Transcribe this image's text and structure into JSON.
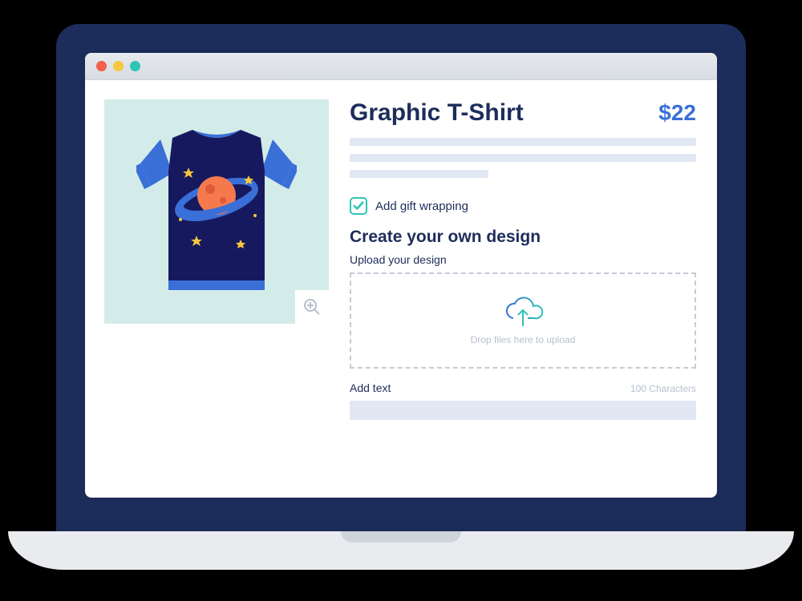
{
  "product": {
    "title": "Graphic T-Shirt",
    "price": "$22",
    "gift_wrap_label": "Add gift wrapping",
    "gift_wrap_checked": true,
    "design_section_title": "Create your own design",
    "upload_label": "Upload your design",
    "dropzone_text": "Drop files here to upload",
    "add_text_label": "Add text",
    "char_limit": "100 Characters"
  },
  "icons": {
    "zoom": "zoom-in-icon",
    "cloud_upload": "cloud-upload-icon",
    "checkbox": "check-icon"
  },
  "colors": {
    "navy": "#1d2d5b",
    "blue": "#3a6fd8",
    "teal": "#2ec4b6",
    "mint_bg": "#d4ece9",
    "skeleton": "#e1e8f3"
  }
}
